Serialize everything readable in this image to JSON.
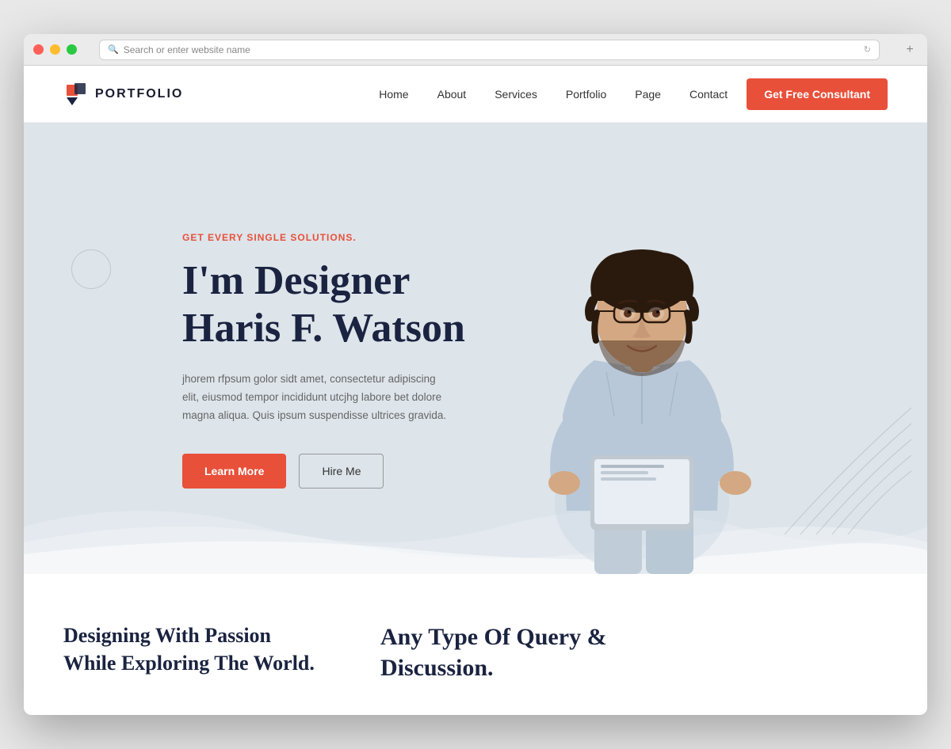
{
  "browser": {
    "address_placeholder": "Search or enter website name"
  },
  "navbar": {
    "logo_text": "PORTFOLIO",
    "nav_items": [
      {
        "label": "Home",
        "id": "home"
      },
      {
        "label": "About",
        "id": "about"
      },
      {
        "label": "Services",
        "id": "services"
      },
      {
        "label": "Portfolio",
        "id": "portfolio"
      },
      {
        "label": "Page",
        "id": "page"
      },
      {
        "label": "Contact",
        "id": "contact"
      }
    ],
    "cta_button": "Get Free Consultant"
  },
  "hero": {
    "eyebrow": "GET EVERY SINGLE SOLUTIONS.",
    "title_line1": "I'm Designer",
    "title_line2": "Haris F. Watson",
    "description": "jhorem rfpsum golor sidt amet, consectetur adipiscing elit, eiusmod tempor incididunt utcjhg labore bet dolore magna aliqua. Quis ipsum suspendisse ultrices gravida.",
    "btn_learn_more": "Learn More",
    "btn_hire_me": "Hire Me"
  },
  "bottom": {
    "left_title": "Designing With Passion While Exploring The World.",
    "right_title": "Any Type Of Query & Discussion."
  }
}
